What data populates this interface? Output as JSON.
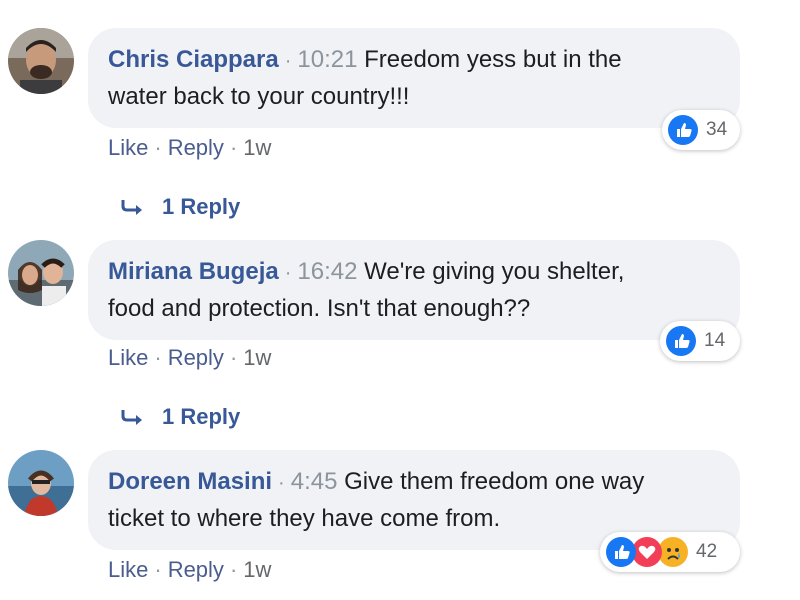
{
  "comments": [
    {
      "author": "Chris Ciappara",
      "time": "10:21",
      "text_line1": "Freedom yess but in the",
      "text_line2": "water back to your country!!!",
      "reaction_count": "34",
      "like_label": "Like",
      "reply_label": "Reply",
      "age": "1w",
      "replies_label": "1 Reply"
    },
    {
      "author": "Miriana Bugeja",
      "time": "16:42",
      "text_line1": "We're giving you shelter,",
      "text_line2": "food and protection. Isn't that enough??",
      "reaction_count": "14",
      "like_label": "Like",
      "reply_label": "Reply",
      "age": "1w",
      "replies_label": "1 Reply"
    },
    {
      "author": "Doreen Masini",
      "time": "4:45",
      "text_line1": "Give them freedom one way",
      "text_line2": "ticket to where they have come from.",
      "reaction_count": "42",
      "like_label": "Like",
      "reply_label": "Reply",
      "age": "1w"
    }
  ],
  "separator": "·",
  "colors": {
    "name": "#385898",
    "bubble": "#f0f2f5",
    "like": "#1877f2",
    "love": "#f33e58",
    "sad": "#f7b125"
  }
}
